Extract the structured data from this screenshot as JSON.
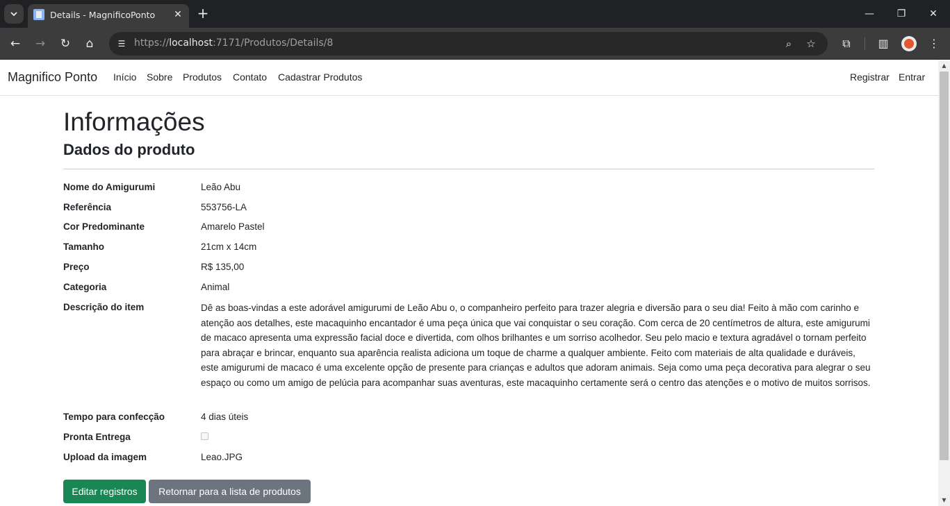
{
  "browser": {
    "tab_title": "Details - MagnificoPonto",
    "url_prefix": "https://",
    "url_host": "localhost",
    "url_path": ":7171/Produtos/Details/8"
  },
  "navbar": {
    "brand": "Magnifico Ponto",
    "links": [
      "Início",
      "Sobre",
      "Produtos",
      "Contato",
      "Cadastrar Produtos"
    ],
    "right_links": [
      "Registrar",
      "Entrar"
    ]
  },
  "page": {
    "title": "Informações",
    "subtitle": "Dados do produto"
  },
  "details": [
    {
      "label": "Nome do Amigurumi",
      "value": "Leão Abu"
    },
    {
      "label": "Referência",
      "value": "553756-LA"
    },
    {
      "label": "Cor Predominante",
      "value": "Amarelo Pastel"
    },
    {
      "label": "Tamanho",
      "value": "21cm x 14cm"
    },
    {
      "label": "Preço",
      "value": "R$ 135,00"
    },
    {
      "label": "Categoria",
      "value": "Animal"
    },
    {
      "label": "Descrição do item",
      "value": "Dê as boas-vindas a este adorável amigurumi de Leão Abu o, o companheiro perfeito para trazer alegria e diversão para o seu dia! Feito à mão com carinho e atenção aos detalhes, este macaquinho encantador é uma peça única que vai conquistar o seu coração. Com cerca de 20 centímetros de altura, este amigurumi de macaco apresenta uma expressão facial doce e divertida, com olhos brilhantes e um sorriso acolhedor. Seu pelo macio e textura agradável o tornam perfeito para abraçar e brincar, enquanto sua aparência realista adiciona um toque de charme a qualquer ambiente. Feito com materiais de alta qualidade e duráveis, este amigurumi de macaco é uma excelente opção de presente para crianças e adultos que adoram animais. Seja como uma peça decorativa para alegrar o seu espaço ou como um amigo de pelúcia para acompanhar suas aventuras, este macaquinho certamente será o centro das atenções e o motivo de muitos sorrisos."
    },
    {
      "label": "Tempo para confecção",
      "value": "4 dias úteis"
    },
    {
      "label": "Pronta Entrega",
      "value": "false"
    },
    {
      "label": "Upload da imagem",
      "value": "Leao.JPG"
    }
  ],
  "buttons": {
    "edit": "Editar registros",
    "back": "Retornar para a lista de produtos"
  },
  "colors": {
    "primary_green": "#198754",
    "secondary_gray": "#6c757d"
  }
}
